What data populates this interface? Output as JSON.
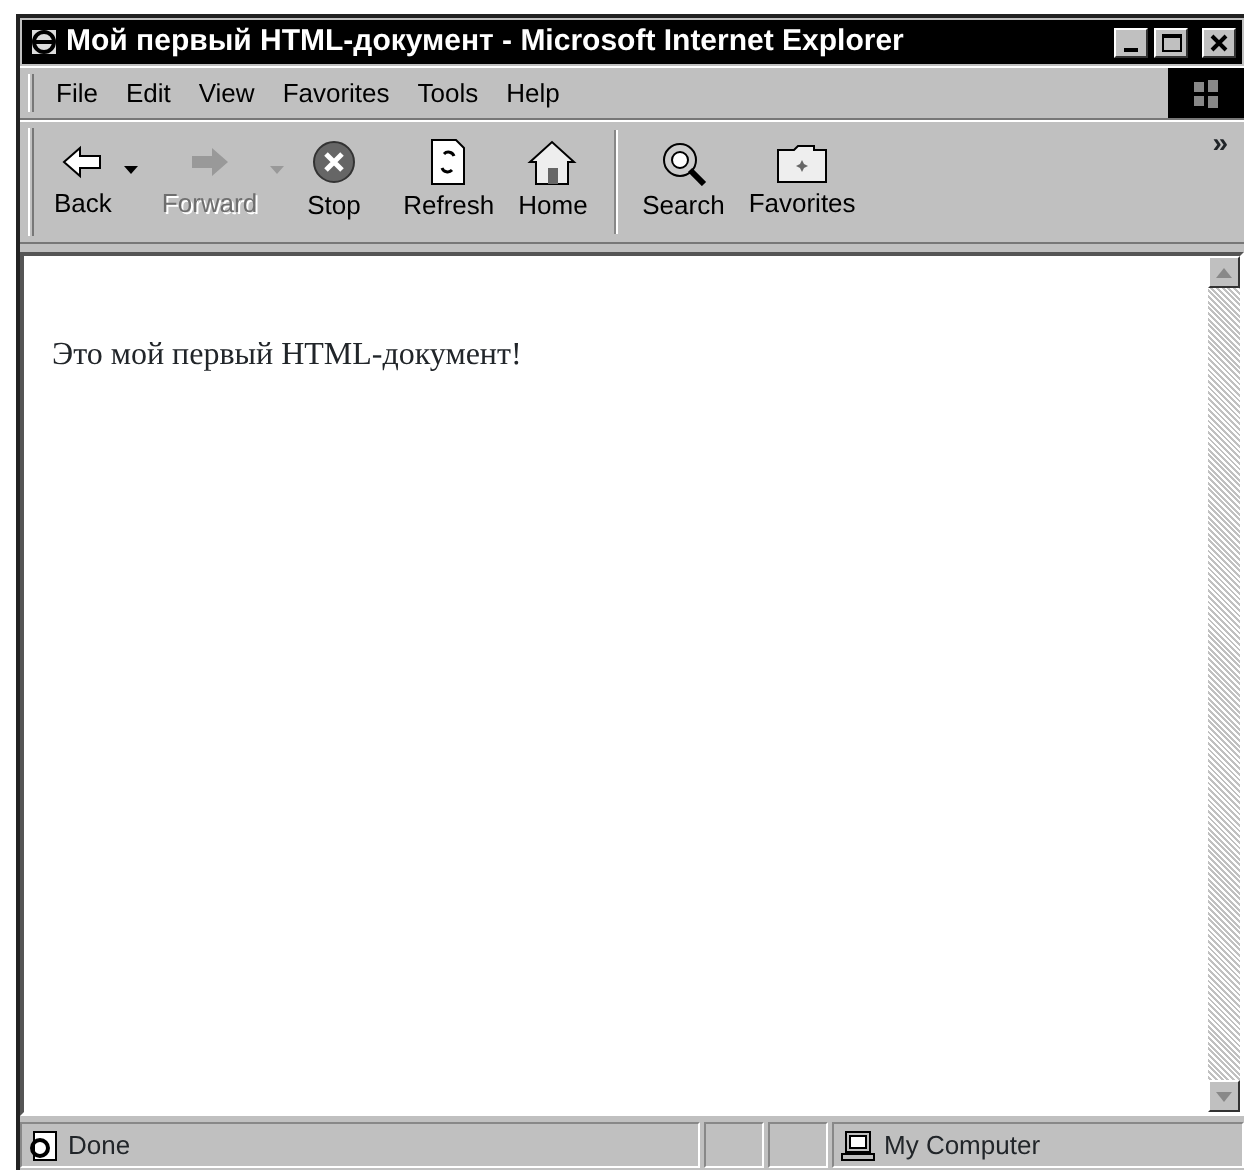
{
  "window": {
    "title": "Мой первый HTML-документ - Microsoft Internet Explorer"
  },
  "menu": [
    "File",
    "Edit",
    "View",
    "Favorites",
    "Tools",
    "Help"
  ],
  "toolbar": {
    "groups": [
      [
        {
          "label": "Back",
          "disabled": false,
          "dropdown": true
        },
        {
          "label": "Forward",
          "disabled": true,
          "dropdown": true
        },
        {
          "label": "Stop",
          "disabled": false,
          "dropdown": false
        },
        {
          "label": "Refresh",
          "disabled": false,
          "dropdown": false
        },
        {
          "label": "Home",
          "disabled": false,
          "dropdown": false
        }
      ],
      [
        {
          "label": "Search",
          "disabled": false,
          "dropdown": false
        },
        {
          "label": "Favorites",
          "disabled": false,
          "dropdown": false
        }
      ]
    ],
    "chevron": "»"
  },
  "content": {
    "text": "Это мой первый HTML-документ!"
  },
  "status_bar": {
    "text": "Done",
    "zone": "My Computer"
  }
}
